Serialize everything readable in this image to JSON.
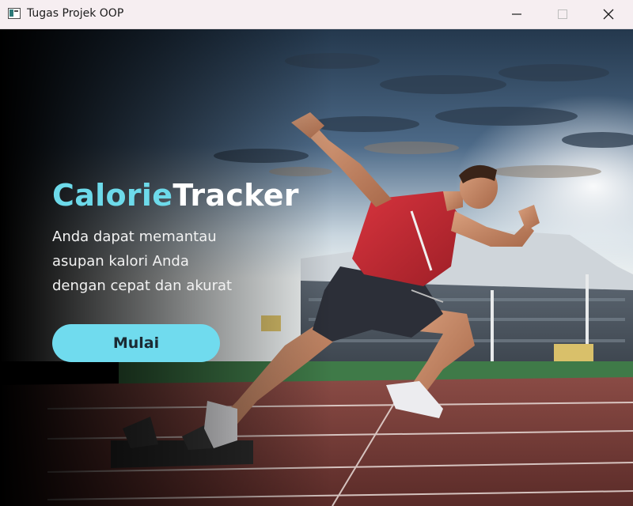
{
  "window": {
    "title": "Tugas Projek OOP",
    "controls": {
      "minimize_icon": "minimize-icon",
      "maximize_icon": "maximize-icon",
      "close_icon": "close-icon"
    }
  },
  "hero": {
    "brand_part1": "Calorie",
    "brand_part2": "Tracker",
    "tagline_lines": [
      "Anda dapat memantau",
      "asupan kalori Anda",
      "dengan cepat dan akurat"
    ],
    "start_button_label": "Mulai",
    "background_image": "sprinter-stadium-photo"
  },
  "colors": {
    "accent": "#6ddaea",
    "button": "#70dbee",
    "button_text": "#1b2a33",
    "text_light": "#ffffff"
  }
}
